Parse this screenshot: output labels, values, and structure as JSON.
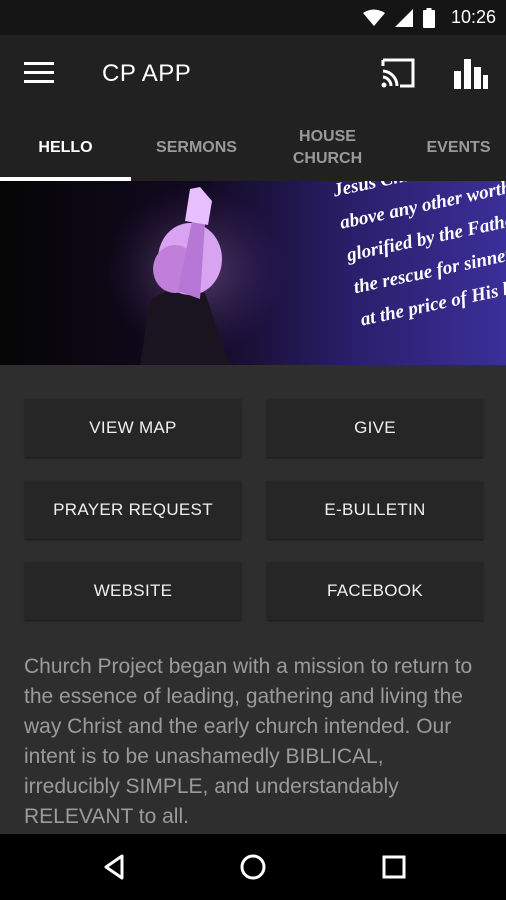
{
  "status_bar": {
    "time": "10:26"
  },
  "app_bar": {
    "title": "CP APP"
  },
  "tabs": [
    {
      "label": "HELLO"
    },
    {
      "label": "SERMONS"
    },
    {
      "label": "HOUSE\nCHURCH"
    },
    {
      "label": "EVENTS"
    }
  ],
  "hero": {
    "lyrics": [
      "Jesus Christ beautiful",
      "above any other worthy of p",
      "glorified by the Father abo",
      "the rescue for sinners",
      "at the price of His blood"
    ]
  },
  "buttons": {
    "view_map": "VIEW MAP",
    "give": "GIVE",
    "prayer_request": "PRAYER REQUEST",
    "e_bulletin": "E-BULLETIN",
    "website": "WEBSITE",
    "facebook": "FACEBOOK"
  },
  "description": "Church Project began with a mission to return to the essence of leading, gathering and living the way Christ and the early church intended. Our intent is to be unashamedly BIBLICAL, irreducibly SIMPLE, and understandably RELEVANT to all.",
  "colors": {
    "background": "#2e2e2e",
    "appbar": "#212121",
    "button": "#262626",
    "text_muted": "#9b9b9b"
  }
}
